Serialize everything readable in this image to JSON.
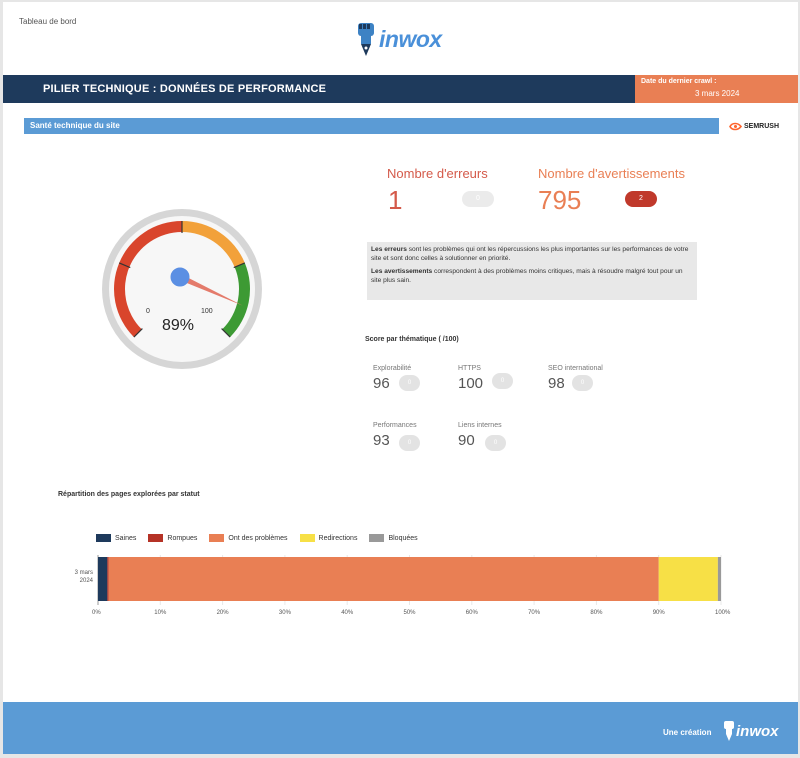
{
  "header": {
    "breadcrumb": "Tableau de bord",
    "logo_text": "inwox",
    "banner_title": "PILIER TECHNIQUE : DONNÉES DE PERFORMANCE",
    "crawl_label": "Date du dernier crawl :",
    "crawl_date": "3 mars 2024"
  },
  "section": {
    "title": "Santé technique du site",
    "provider": "SEMRUSH"
  },
  "gauge": {
    "value_label": "89%",
    "value": 89,
    "min_label": "0",
    "max_label": "100",
    "colors": {
      "red": "#d9452c",
      "orange": "#f2a13a",
      "green": "#3d9a34",
      "needle": "#e47b6b",
      "hub": "#5b8fe3"
    }
  },
  "errors": {
    "title": "Nombre d'erreurs",
    "value": "1",
    "delta": "0"
  },
  "warnings": {
    "title": "Nombre d'avertissements",
    "value": "795",
    "delta": "2"
  },
  "info": {
    "p1_bold": "Les erreurs",
    "p1_text": " sont les problèmes qui ont les répercussions les plus importantes sur les performances de votre site et sont donc celles à solutionner en priorité.",
    "p2_bold": "Les avertissements",
    "p2_text": " correspondent à des problèmes moins critiques, mais à résoudre malgré tout pour un site plus sain."
  },
  "scores": {
    "title": "Score par thématique ( /100)",
    "items": [
      {
        "label": "Explorabilité",
        "value": "96",
        "delta": "0"
      },
      {
        "label": "HTTPS",
        "value": "100",
        "delta": "0"
      },
      {
        "label": "SEO international",
        "value": "98",
        "delta": "0"
      },
      {
        "label": "Performances",
        "value": "93",
        "delta": "0"
      },
      {
        "label": "Liens internes",
        "value": "90",
        "delta": "0"
      }
    ]
  },
  "chart_data": {
    "type": "bar",
    "orientation": "horizontal",
    "stacked": true,
    "title": "Répartition des pages explorées par statut",
    "categories": [
      "3 mars 2024"
    ],
    "series": [
      {
        "name": "Saines",
        "values": [
          1.5
        ],
        "color": "#1e3a5c"
      },
      {
        "name": "Rompues",
        "values": [
          0.2
        ],
        "color": "#b53226"
      },
      {
        "name": "Ont des problèmes",
        "values": [
          88.3
        ],
        "color": "#e97f54"
      },
      {
        "name": "Redirections",
        "values": [
          9.5
        ],
        "color": "#f7e046"
      },
      {
        "name": "Bloquées",
        "values": [
          0.5
        ],
        "color": "#999999"
      }
    ],
    "xlim": [
      0,
      100
    ],
    "xticks": [
      "0%",
      "10%",
      "20%",
      "30%",
      "40%",
      "50%",
      "60%",
      "70%",
      "80%",
      "90%",
      "100%"
    ],
    "legend_position": "top"
  },
  "footer": {
    "text": "Une création",
    "logo_text": "inwox"
  }
}
